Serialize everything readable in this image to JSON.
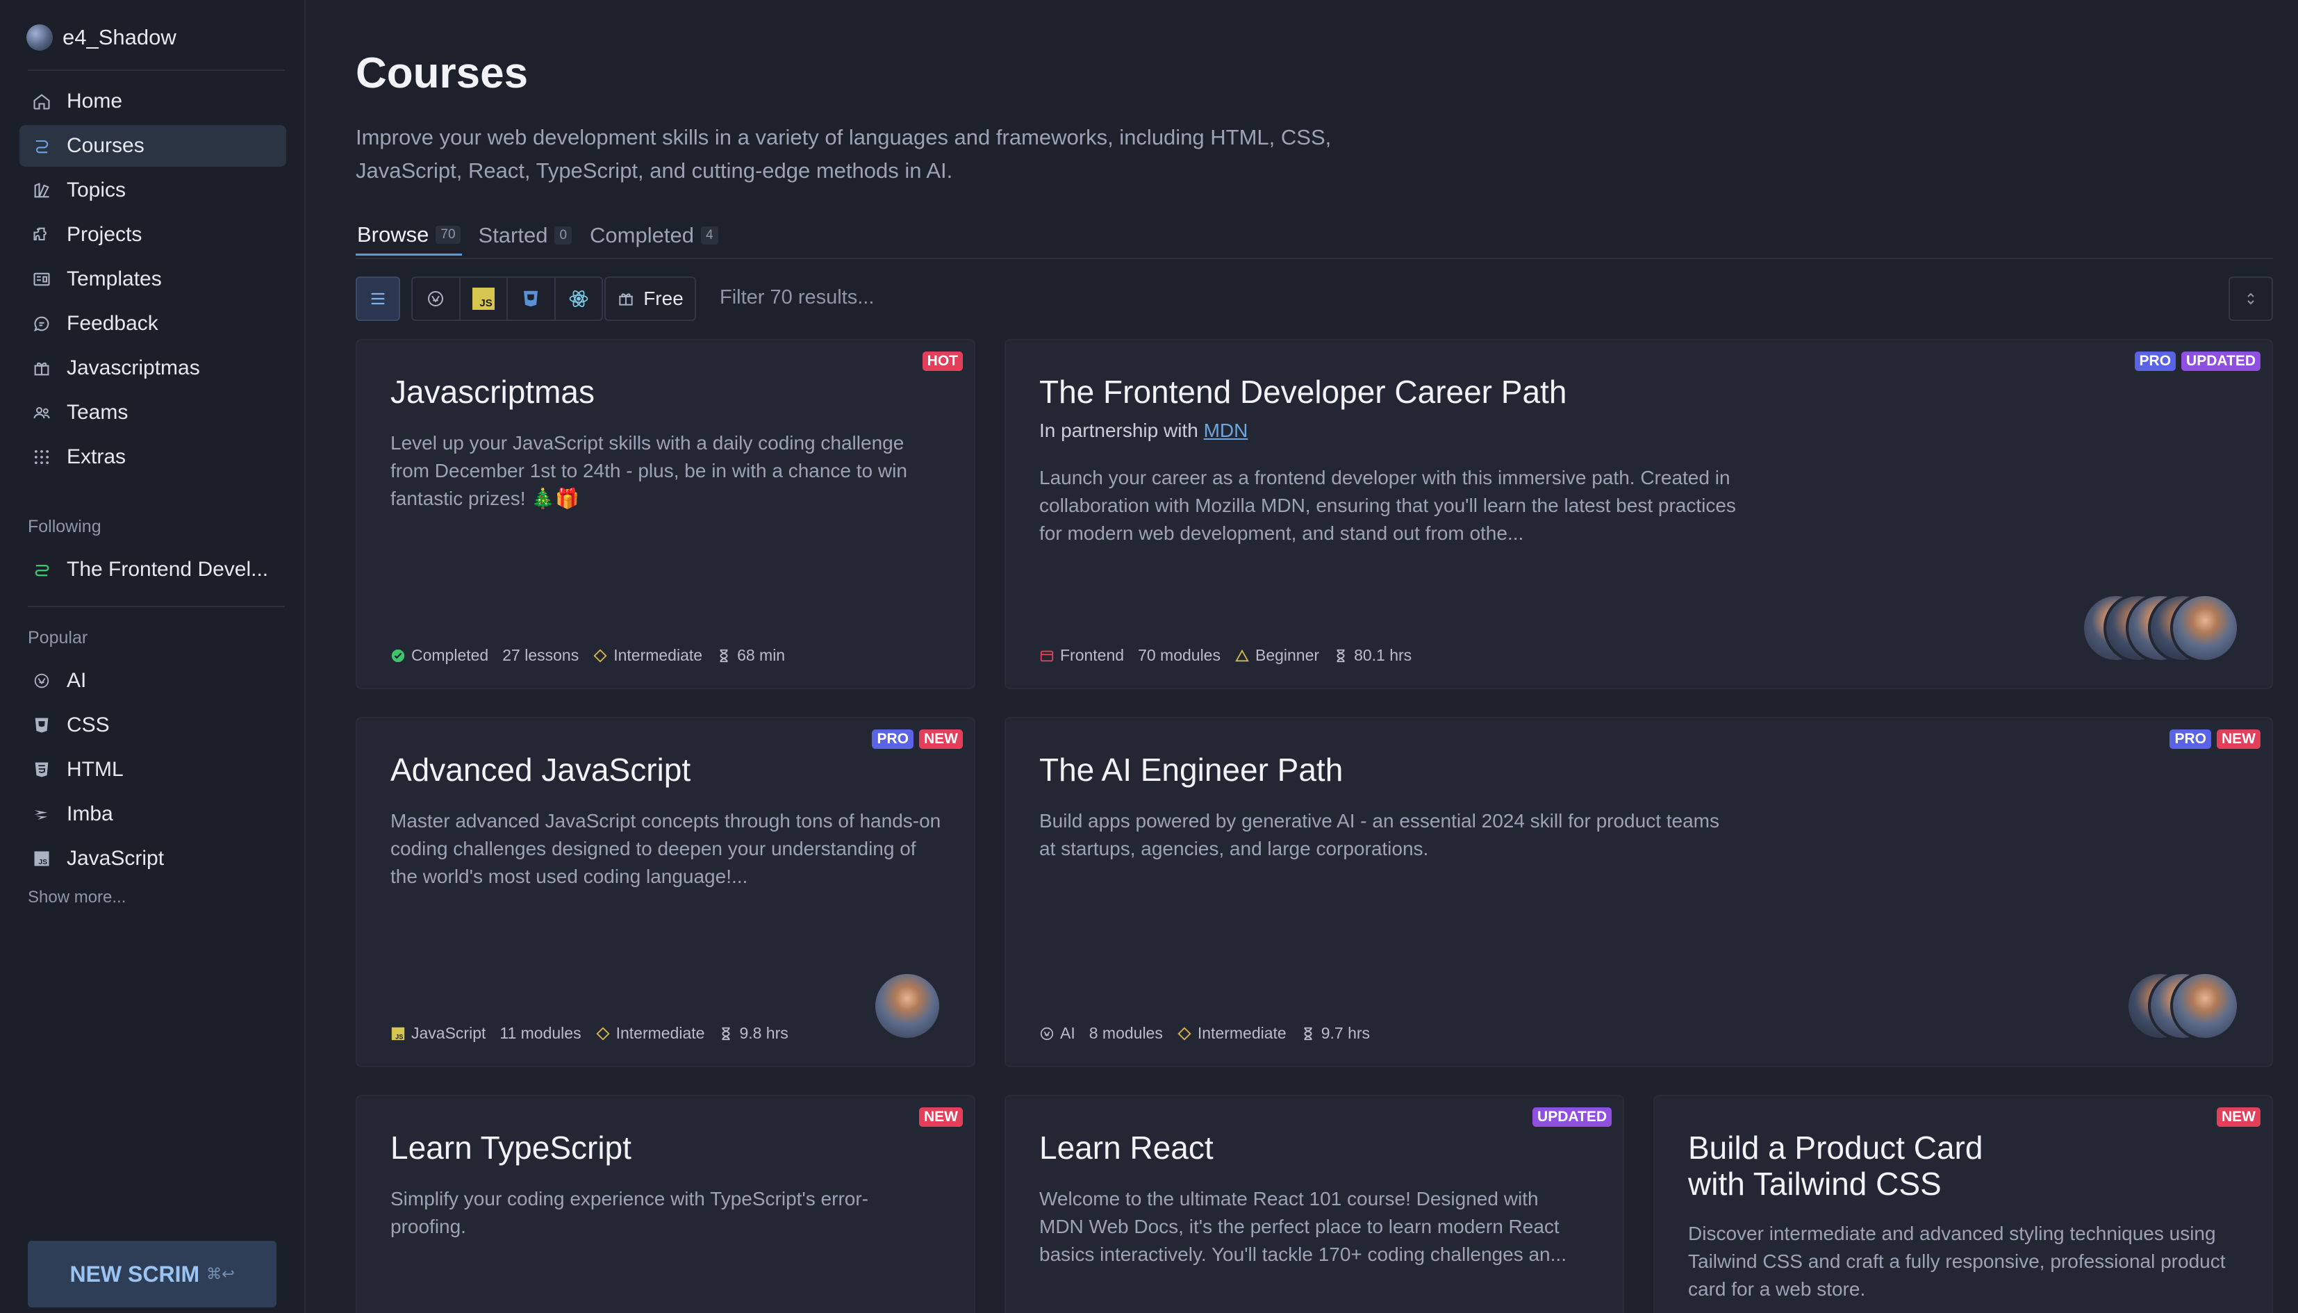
{
  "user": {
    "name": "e4_Shadow"
  },
  "nav": [
    {
      "label": "Home",
      "icon": "home-icon"
    },
    {
      "label": "Courses",
      "icon": "courses-icon",
      "active": true
    },
    {
      "label": "Topics",
      "icon": "topics-icon"
    },
    {
      "label": "Projects",
      "icon": "projects-icon"
    },
    {
      "label": "Templates",
      "icon": "templates-icon"
    },
    {
      "label": "Feedback",
      "icon": "feedback-icon"
    },
    {
      "label": "Javascriptmas",
      "icon": "gift-icon"
    },
    {
      "label": "Teams",
      "icon": "teams-icon"
    },
    {
      "label": "Extras",
      "icon": "extras-icon"
    }
  ],
  "following": {
    "heading": "Following",
    "items": [
      {
        "label": "The Frontend Devel...",
        "icon": "path-icon"
      }
    ]
  },
  "popular": {
    "heading": "Popular",
    "items": [
      {
        "label": "AI",
        "icon": "ai-icon"
      },
      {
        "label": "CSS",
        "icon": "css-icon"
      },
      {
        "label": "HTML",
        "icon": "html-icon"
      },
      {
        "label": "Imba",
        "icon": "imba-icon"
      },
      {
        "label": "JavaScript",
        "icon": "javascript-icon"
      }
    ],
    "show_more": "Show more..."
  },
  "new_scrim": {
    "label": "NEW SCRIM",
    "shortcut": "⌘↩"
  },
  "page": {
    "title": "Courses",
    "description": "Improve your web development skills in a variety of languages and frameworks, including HTML, CSS, JavaScript, React, TypeScript, and cutting-edge methods in AI."
  },
  "tabs": [
    {
      "label": "Browse",
      "count": "70",
      "active": true
    },
    {
      "label": "Started",
      "count": "0"
    },
    {
      "label": "Completed",
      "count": "4"
    }
  ],
  "toolbar": {
    "free_label": "Free",
    "filter_placeholder": "Filter 70 results..."
  },
  "cards": [
    {
      "title": "Javascriptmas",
      "badges": [
        "HOT"
      ],
      "description": "Level up your JavaScript skills with a daily coding challenge from December 1st to 24th - plus, be in with a chance to win fantastic prizes! 🎄🎁",
      "meta": {
        "topic": "Completed",
        "units": "27 lessons",
        "level": "Intermediate",
        "duration": "68 min"
      }
    },
    {
      "title": "The Frontend Developer Career Path",
      "badges": [
        "PRO",
        "UPDATED"
      ],
      "partner_prefix": "In partnership with",
      "partner_link": "MDN",
      "description": "Launch your career as a frontend developer with this immersive path. Created in collaboration with Mozilla MDN, ensuring that you'll learn the latest best practices for modern web development, and stand out from othe...",
      "meta": {
        "topic": "Frontend",
        "units": "70 modules",
        "level": "Beginner",
        "duration": "80.1 hrs"
      }
    },
    {
      "title": "Advanced JavaScript",
      "badges": [
        "PRO",
        "NEW"
      ],
      "description": "Master advanced JavaScript concepts through tons of hands-on coding challenges designed to deepen your understanding of the world's most used coding language!...",
      "meta": {
        "topic": "JavaScript",
        "units": "11 modules",
        "level": "Intermediate",
        "duration": "9.8 hrs"
      }
    },
    {
      "title": "The AI Engineer Path",
      "badges": [
        "PRO",
        "NEW"
      ],
      "description": "Build apps powered by generative AI - an essential 2024 skill for product teams at startups, agencies, and large corporations.",
      "meta": {
        "topic": "AI",
        "units": "8 modules",
        "level": "Intermediate",
        "duration": "9.7 hrs"
      }
    },
    {
      "title": "Learn TypeScript",
      "badges": [
        "NEW"
      ],
      "description": "Simplify your coding experience with TypeScript's error-proofing."
    },
    {
      "title": "Learn React",
      "badges": [
        "UPDATED"
      ],
      "description": "Welcome to the ultimate React 101 course! Designed with MDN Web Docs, it's the perfect place to learn modern React basics interactively. You'll tackle 170+ coding challenges an..."
    },
    {
      "title": "Build a Product Card with Tailwind CSS",
      "badges": [
        "NEW"
      ],
      "description": "Discover intermediate and advanced styling techniques using Tailwind CSS and craft a fully responsive, professional product card for a web store."
    }
  ],
  "colors": {
    "background": "#1c212c",
    "sidebar": "#1a1f29",
    "card": "#222733",
    "accent": "#5b9ae0",
    "badge_hot_new": "#e2405a",
    "badge_pro": "#5a63e6",
    "badge_updated": "#8f4fe0",
    "completed_green": "#3ec46d",
    "level_yellow": "#d9b64a"
  }
}
